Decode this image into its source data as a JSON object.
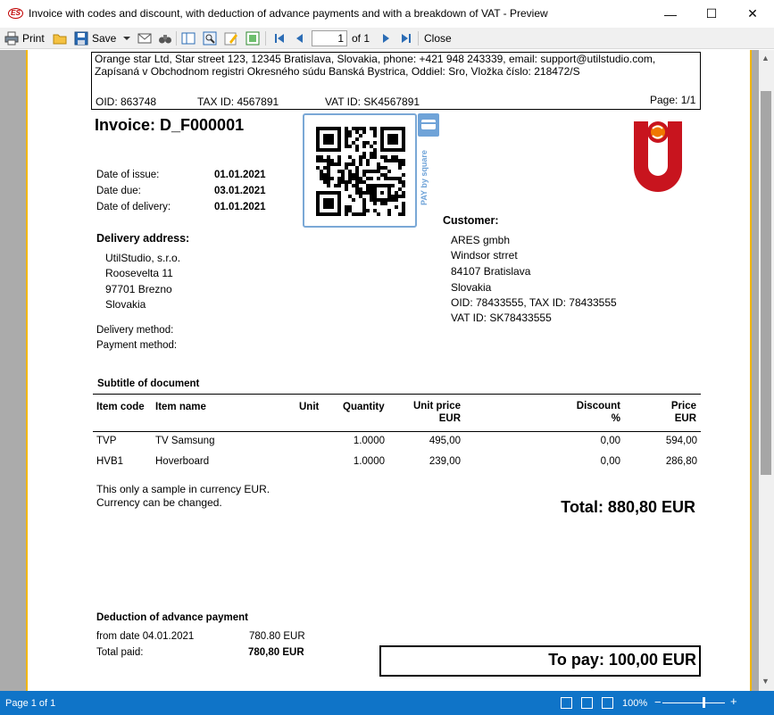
{
  "window": {
    "title": "Invoice with codes and discount, with deduction of advance payments and with a breakdown of VAT - Preview",
    "app_icon_text": "ES",
    "minimize": "—",
    "maximize": "☐",
    "close": "✕"
  },
  "toolbar": {
    "print_label": "Print",
    "save_label": "Save",
    "page_value": "1",
    "page_of": "of 1",
    "close_label": "Close"
  },
  "document": {
    "company_line1": "Orange star Ltd, Star street 123, 12345 Bratislava, Slovakia, phone: +421 948 243339, email: support@utilstudio.com,",
    "company_line2": "Zapísaná v Obchodnom registri Okresného súdu Banská Bystrica, Oddiel: Sro, Vložka číslo:  218472/S",
    "oid": "OID: 863748",
    "tax_id": "TAX ID: 4567891",
    "vat_id": "VAT ID: SK4567891",
    "page": "Page: 1/1",
    "invoice_title": "Invoice: D_F000001",
    "dates": [
      {
        "label": "Date of issue:",
        "value": "01.01.2021"
      },
      {
        "label": "Date due:",
        "value": "03.01.2021"
      },
      {
        "label": "Date of delivery:",
        "value": "01.01.2021"
      }
    ],
    "delivery_title": "Delivery address:",
    "delivery_lines": [
      "UtilStudio, s.r.o.",
      "Roosevelta 11",
      "97701 Brezno",
      "Slovakia"
    ],
    "delivery_method": "Delivery method:",
    "payment_method": "Payment method:",
    "customer_title": "Customer:",
    "customer_lines": [
      "ARES gmbh",
      "Windsor strret",
      "84107 Bratislava",
      "Slovakia",
      "OID: 78433555, TAX ID: 78433555",
      "VAT ID: SK78433555"
    ],
    "pay_by_square": "PAY by square",
    "subtitle": "Subtitle of document",
    "table": {
      "headers": {
        "code": "Item code",
        "name": "Item name",
        "unit": "Unit",
        "quantity": "Quantity",
        "unit_price": "Unit price",
        "unit_price_cur": "EUR",
        "discount": "Discount",
        "discount_unit": "%",
        "price": "Price",
        "price_cur": "EUR"
      },
      "rows": [
        {
          "code": "TVP",
          "name": "TV Samsung",
          "unit": "",
          "quantity": "1.0000",
          "unit_price": "495,00",
          "discount": "0,00",
          "price": "594,00"
        },
        {
          "code": "HVB1",
          "name": "Hoverboard",
          "unit": "",
          "quantity": "1.0000",
          "unit_price": "239,00",
          "discount": "0,00",
          "price": "286,80"
        }
      ]
    },
    "note_line1": "This only a sample in currency EUR.",
    "note_line2": "Currency can be changed.",
    "total": "Total: 880,80 EUR",
    "deduction_title": "Deduction of advance payment",
    "deduction_from": "from date 04.01.2021",
    "deduction_amount": "780.80 EUR",
    "total_paid_label": "Total paid:",
    "total_paid_value": "780,80 EUR",
    "to_pay": "To pay: 100,00 EUR"
  },
  "status": {
    "page_text": "Page 1 of 1",
    "zoom": "100%",
    "zoom_minus": "−",
    "zoom_plus": "+"
  },
  "colors": {
    "logo_red": "#c8141e",
    "logo_orange": "#f07800",
    "status_blue": "#0f74c8",
    "paper_border": "#f2b600"
  }
}
